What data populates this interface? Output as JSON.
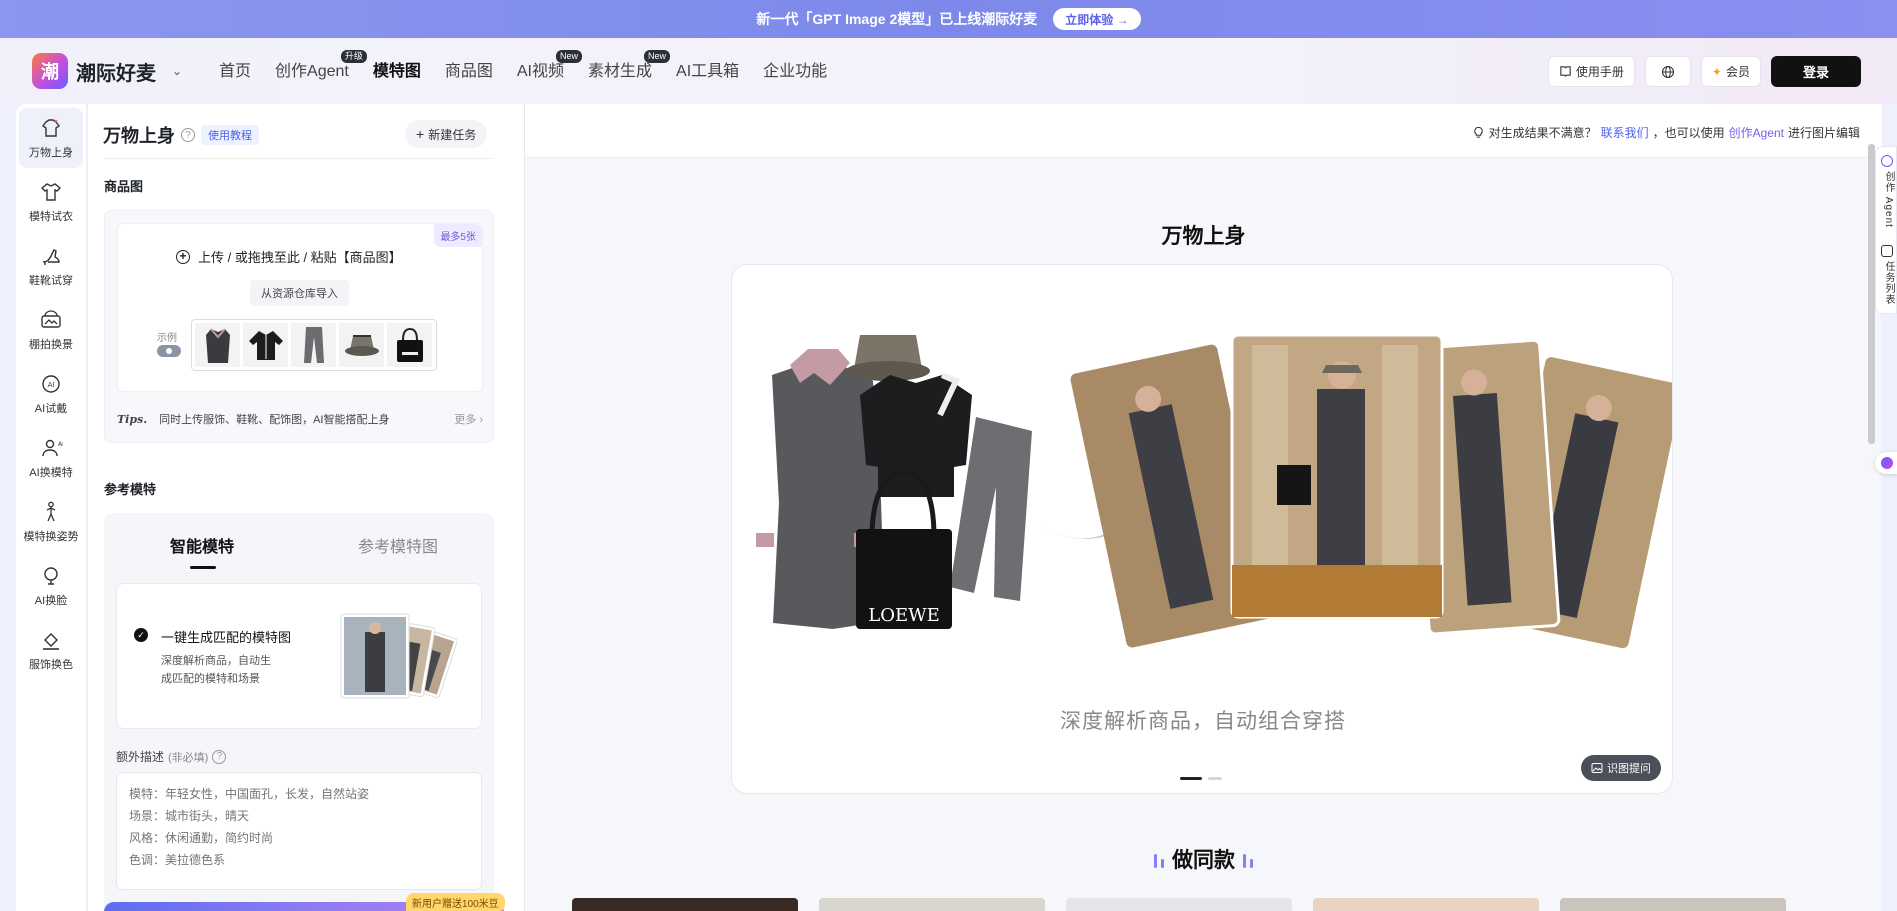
{
  "banner": {
    "text": "新一代「GPT Image 2模型」已上线潮际好麦",
    "cta": "立即体验 →"
  },
  "brand": {
    "name": "潮际好麦",
    "logo_glyph": "潮"
  },
  "nav": [
    {
      "label": "首页",
      "badge": ""
    },
    {
      "label": "创作Agent",
      "badge": "升级"
    },
    {
      "label": "模特图",
      "badge": "",
      "active": true
    },
    {
      "label": "商品图",
      "badge": ""
    },
    {
      "label": "AI视频",
      "badge": "New"
    },
    {
      "label": "素材生成",
      "badge": "New"
    },
    {
      "label": "AI工具箱",
      "badge": ""
    },
    {
      "label": "企业功能",
      "badge": ""
    }
  ],
  "header_actions": {
    "manual": "使用手册",
    "vip": "会员",
    "login": "登录"
  },
  "rail": [
    {
      "label": "万物上身",
      "icon": "shirt-sparkle-icon",
      "active": true
    },
    {
      "label": "模特试衣",
      "icon": "tshirt-icon"
    },
    {
      "label": "鞋靴试穿",
      "icon": "high-heel-icon"
    },
    {
      "label": "棚拍换景",
      "icon": "landscape-icon"
    },
    {
      "label": "AI试戴",
      "icon": "accessory-icon"
    },
    {
      "label": "AI换模特",
      "icon": "person-swap-icon"
    },
    {
      "label": "模特换姿势",
      "icon": "pose-icon"
    },
    {
      "label": "AI换脸",
      "icon": "face-swap-icon"
    },
    {
      "label": "服饰换色",
      "icon": "paint-bucket-icon"
    }
  ],
  "panel": {
    "title": "万物上身",
    "tutorial": "使用教程",
    "new_task": "新建任务",
    "product_section": "商品图",
    "max_badge": "最多5张",
    "upload_text": "上传 / 或拖拽至此 / 粘贴【商品图】",
    "library_btn": "从资源仓库导入",
    "example_label": "示例",
    "tips_label": "Tips.",
    "tips_text": "同时上传服饰、鞋靴、配饰图，AI智能搭配上身",
    "more": "更多",
    "model_section": "参考模特",
    "tab_smart": "智能模特",
    "tab_ref": "参考模特图",
    "card_title": "一键生成匹配的模特图",
    "card_desc": "深度解析商品，自动生成匹配的模特和场景",
    "desc_label": "额外描述",
    "desc_optional": "(非必填)",
    "desc_placeholder": "模特：年轻女性，中国面孔，长发，自然站姿\n场景：城市街头，晴天\n风格：休闲通勤，简约时尚\n色调：美拉德色系",
    "gift_badge": "新用户赠送100米豆"
  },
  "main": {
    "hint_pre": "对生成结果不满意？",
    "hint_link": "联系我们",
    "hint_mid": "，也可以使用",
    "hint_link2": "创作Agent",
    "hint_post": "进行图片编辑",
    "stage_title": "万物上身",
    "stage_caption": "深度解析商品，自动组合穿搭",
    "prompt_btn": "识图提问",
    "bag_brand": "LOEWE",
    "same_title": "做同款"
  },
  "side_float": {
    "agent": "创作 Agent",
    "tasks": "任务列表"
  },
  "colors": {
    "accent": "#4b63e6",
    "banner": "#8b97ee",
    "login_bg": "#111111"
  }
}
